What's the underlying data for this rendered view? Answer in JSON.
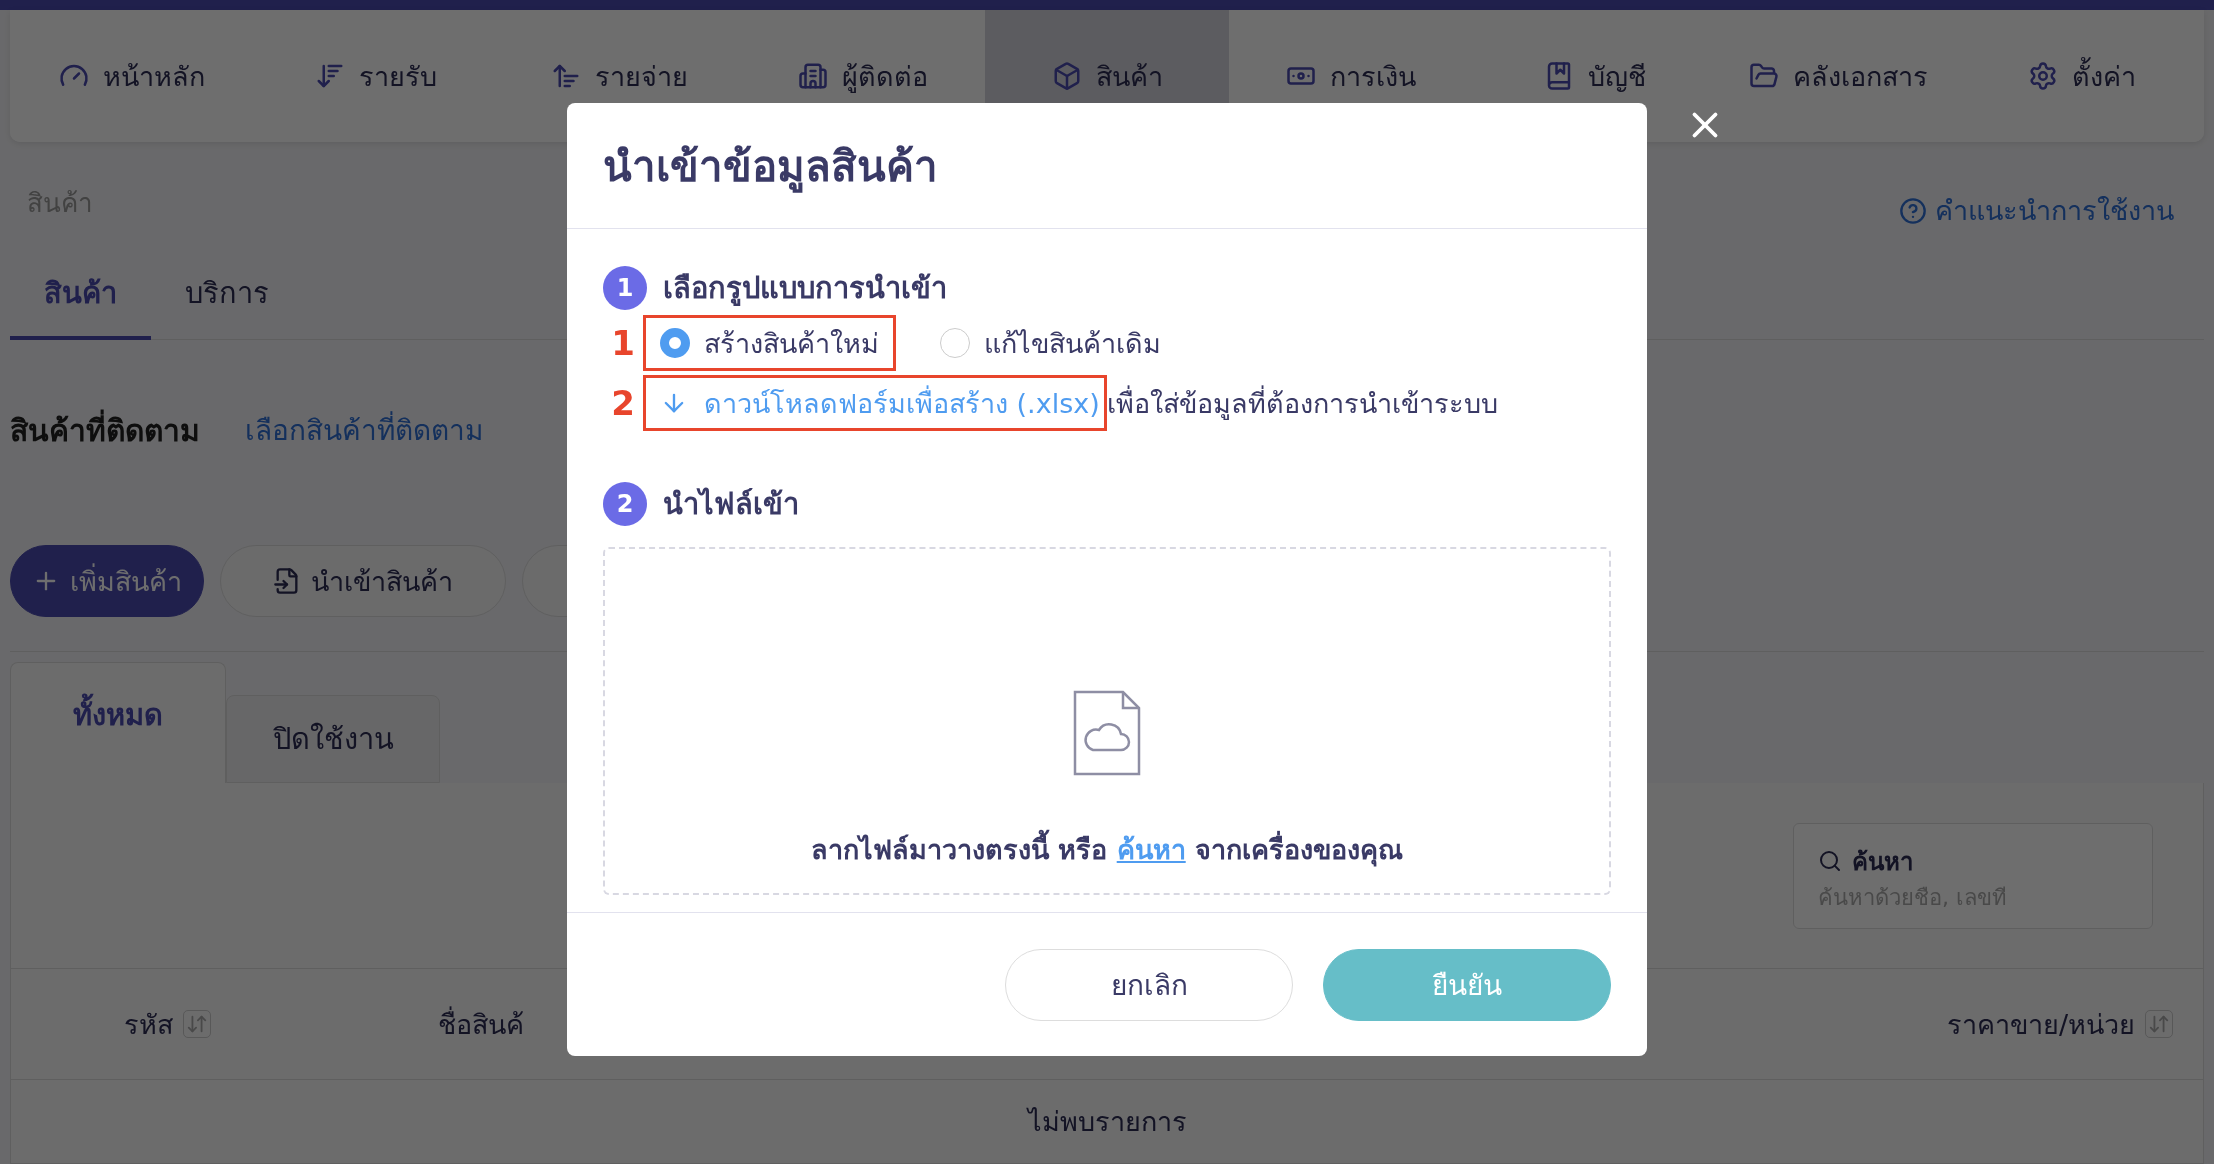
{
  "nav": [
    {
      "label": "หน้าหลัก",
      "selected": false
    },
    {
      "label": "รายรับ",
      "selected": false
    },
    {
      "label": "รายจ่าย",
      "selected": false
    },
    {
      "label": "ผู้ติดต่อ",
      "selected": false
    },
    {
      "label": "สินค้า",
      "selected": true
    },
    {
      "label": "การเงิน",
      "selected": false
    },
    {
      "label": "บัญชี",
      "selected": false
    },
    {
      "label": "คลังเอกสาร",
      "selected": false
    },
    {
      "label": "ตั้งค่า",
      "selected": false
    }
  ],
  "breadcrumb": "สินค้า",
  "help_link": "คำแนะนำการใช้งาน",
  "tabs": [
    {
      "label": "สินค้า",
      "selected": true
    },
    {
      "label": "บริการ",
      "selected": false
    }
  ],
  "watchlist": {
    "title": "สินค้าที่ติดตาม",
    "link": "เลือกสินค้าที่ติดตาม"
  },
  "actions": {
    "add": "เพิ่มสินค้า",
    "import": "นำเข้าสินค้า"
  },
  "subtabs": [
    {
      "label": "ทั้งหมด",
      "selected": true
    },
    {
      "label": "ปิดใช้งาน",
      "selected": false
    }
  ],
  "search": {
    "label": "ค้นหา",
    "placeholder": "ค้นหาด้วยชื่อ, เลขที่"
  },
  "table": {
    "columns": [
      "รหัส",
      "ชื่อสินค้",
      "ราคาขาย/หน่วย"
    ],
    "empty": "ไม่พบรายการ"
  },
  "modal": {
    "title": "นำเข้าข้อมูลสินค้า",
    "step1": {
      "number": "1",
      "title": "เลือกรูปแบบการนำเข้า",
      "options": [
        {
          "label": "สร้างสินค้าใหม่",
          "selected": true
        },
        {
          "label": "แก้ไขสินค้าเดิม",
          "selected": false
        }
      ],
      "download_link": "ดาวน์โหลดฟอร์มเพื่อสร้าง (.xlsx)",
      "download_note": "เพื่อใส่ข้อมูลที่ต้องการนำเข้าระบบ"
    },
    "annotations": [
      "1",
      "2"
    ],
    "step2": {
      "number": "2",
      "title": "นำไฟล์เข้า",
      "drop_text_before": "ลากไฟล์มาวางตรงนี้ หรือ",
      "browse_link": "ค้นหา",
      "drop_text_after": "จากเครื่องของคุณ"
    },
    "buttons": {
      "cancel": "ยกเลิก",
      "confirm": "ยืนยัน"
    }
  }
}
